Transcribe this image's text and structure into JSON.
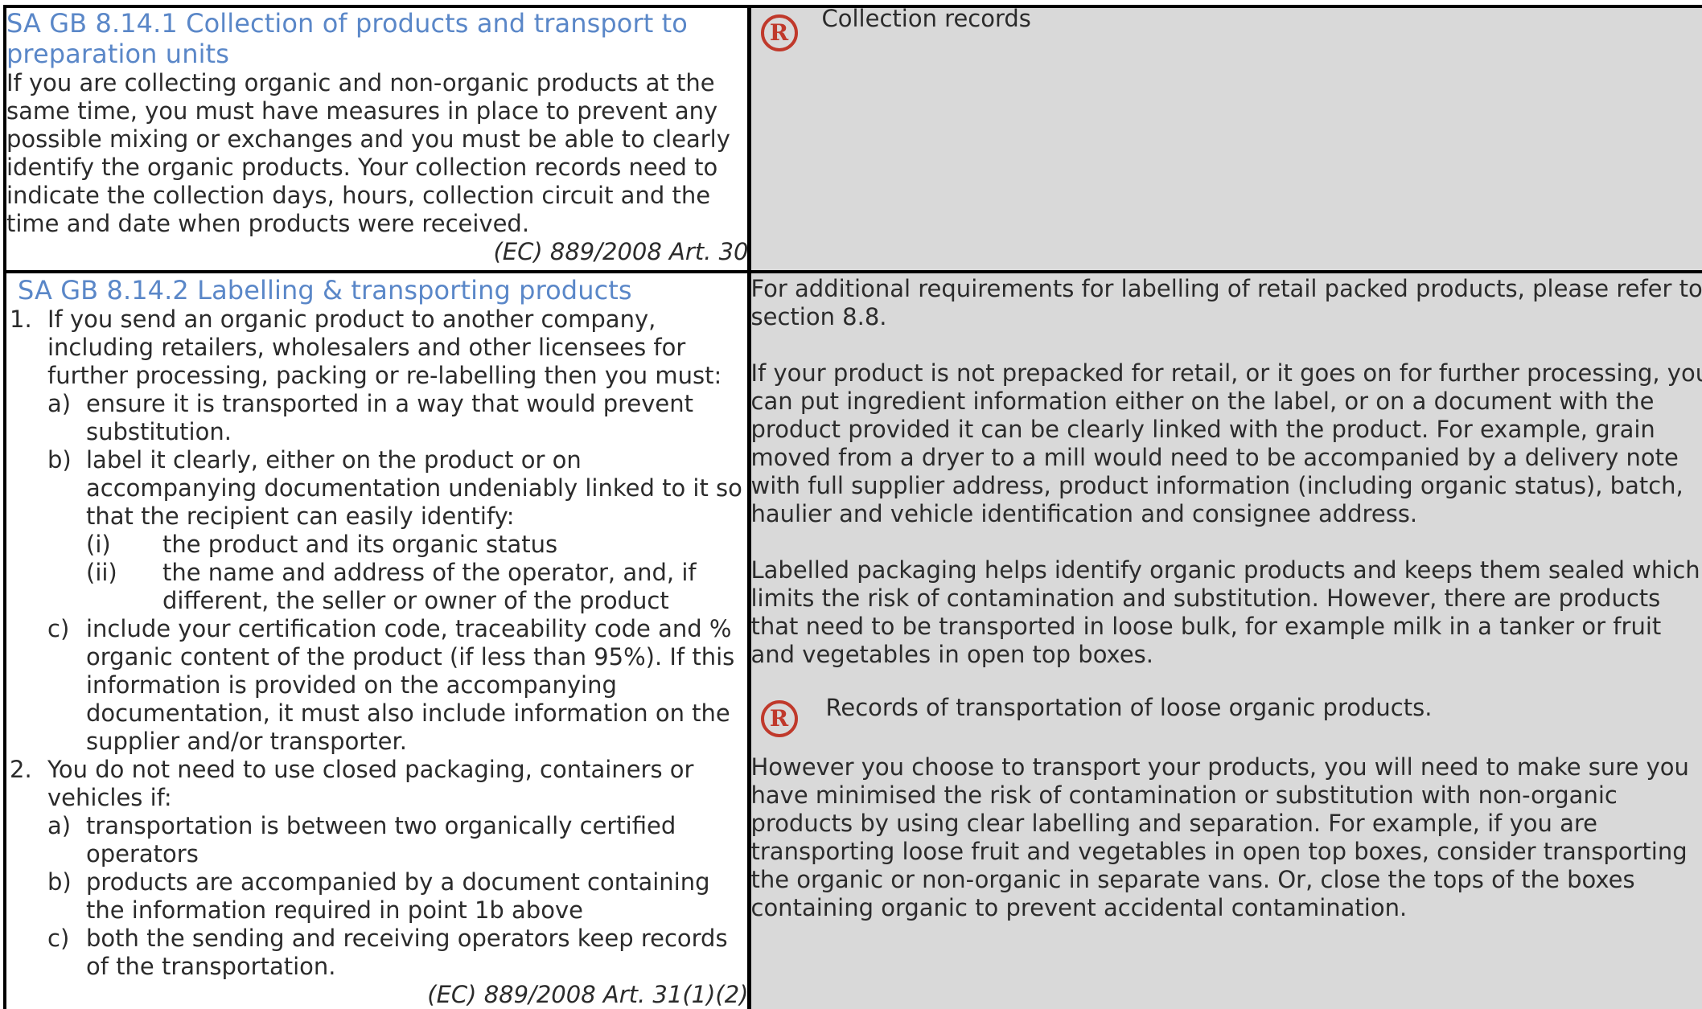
{
  "row1": {
    "heading": "SA GB 8.14.1 Collection of products and transport to preparation units",
    "body": "If you are collecting organic and non-organic products at the same time, you must have measures in place to prevent any possible mixing or exchanges and you must be able to clearly identify the organic products. Your collection records need to indicate the collection days, hours, collection circuit and the time and date when products were received.",
    "reference": "(EC) 889/2008 Art. 30",
    "records_icon": "R",
    "records_label": "Collection records"
  },
  "row2": {
    "heading": "SA GB 8.14.2 Labelling & transporting products",
    "items": [
      {
        "marker": "1.",
        "text": "If you send an organic product to another company, including retailers, wholesalers and other licensees for further processing, packing or re-labelling then you must:",
        "subitems": [
          {
            "marker": "a)",
            "text": "ensure it is transported in a way that would prevent substitution."
          },
          {
            "marker": "b)",
            "text": "label it clearly, either on the product or on accompanying documentation undeniably linked to it so that the recipient can easily identify:",
            "subsubitems": [
              {
                "marker": "(i)",
                "text": "the product and its organic status"
              },
              {
                "marker": "(ii)",
                "text": "the name and address of the operator, and, if different, the seller or owner of the product"
              }
            ]
          },
          {
            "marker": "c)",
            "text": "include your certification code, traceability code and % organic content of the product (if less than 95%). If this information is provided on the accompanying documentation, it must also include information on the supplier and/or transporter."
          }
        ]
      },
      {
        "marker": "2.",
        "text": "You do not need to use closed packaging, containers or vehicles if:",
        "subitems": [
          {
            "marker": "a)",
            "text": "transportation is between two organically certified operators"
          },
          {
            "marker": "b)",
            "text": "products are accompanied by a document containing the information required in point 1b above"
          },
          {
            "marker": "c)",
            "text": "both the sending and receiving operators keep records of the transportation."
          }
        ]
      }
    ],
    "reference": "(EC) 889/2008 Art. 31(1)(2)",
    "guidance": {
      "para1": "For additional requirements for labelling of retail packed products, please refer to section 8.8.",
      "para2": "If your product is not prepacked for retail, or it goes on for further processing, you can put ingredient information either on the label, or on a document with the product provided it can be clearly linked with the product. For example, grain moved from a dryer to a mill would need to be accompanied by a delivery note with full supplier address, product information (including organic status), batch, haulier and vehicle identification and consignee address.",
      "para3": "Labelled packaging helps identify organic products and keeps them sealed which limits the risk of contamination and substitution. However, there are products that need to be transported in loose bulk, for example milk in a tanker or fruit and vegetables in open top boxes.",
      "records_icon": "R",
      "records_label": "Records of transportation of loose organic products.",
      "para4": "However you choose to transport your products, you will need to make sure you have minimised the risk of contamination or substitution with non-organic products by using clear labelling and separation.  For example, if you are transporting loose fruit and vegetables in open top boxes, consider transporting the organic or non-organic in separate vans. Or, close the tops of the boxes containing organic to prevent accidental contamination."
    }
  },
  "colors": {
    "heading": "#5a87c8",
    "guidance_bg": "#d9d9d9",
    "records_icon": "#c0392b",
    "border": "#000000"
  }
}
